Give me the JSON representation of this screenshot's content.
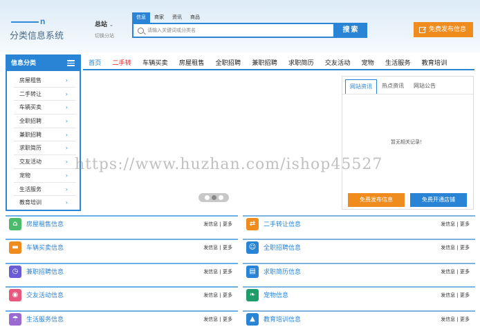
{
  "header": {
    "logo_url": "n",
    "logo_text": "分类信息系统",
    "city_name": "总站",
    "city_caret": "⌄",
    "city_switch": "切换分站",
    "post_button": "免费发布信息"
  },
  "search": {
    "tabs": [
      "信息",
      "商家",
      "资讯",
      "商品"
    ],
    "active_tab": 0,
    "placeholder": "请输入关键词或分类名",
    "button": "搜索"
  },
  "sidebar": {
    "title": "信息分类",
    "items": [
      {
        "label": "房屋租售"
      },
      {
        "label": "二手转让"
      },
      {
        "label": "车辆买卖"
      },
      {
        "label": "全职招聘"
      },
      {
        "label": "兼职招聘"
      },
      {
        "label": "求职简历"
      },
      {
        "label": "交友活动"
      },
      {
        "label": "宠物"
      },
      {
        "label": "生活服务"
      },
      {
        "label": "教育培训"
      }
    ]
  },
  "nav": {
    "items": [
      "首页",
      "二手转",
      "车辆买卖",
      "房屋租售",
      "全职招聘",
      "兼职招聘",
      "求职简历",
      "交友活动",
      "宠物",
      "生活服务",
      "教育培训"
    ]
  },
  "info_box": {
    "tabs": [
      "网站资讯",
      "热点资讯",
      "网站公告"
    ],
    "empty_text": "暂无相关记录！",
    "btn_post": "免费发布信息",
    "btn_shop": "免费开通店铺"
  },
  "sections": [
    {
      "title": "房屋租售信息",
      "links": "发信息 | 更多",
      "color": "#4cbb6b",
      "icon": "house-icon"
    },
    {
      "title": "二手转让信息",
      "links": "发信息 | 更多",
      "color": "#f08c1e",
      "icon": "transfer-icon"
    },
    {
      "title": "车辆买卖信息",
      "links": "发信息 | 更多",
      "color": "#f08c1e",
      "icon": "car-icon"
    },
    {
      "title": "全职招聘信息",
      "links": "发信息 | 更多",
      "color": "#2a84d6",
      "icon": "job-icon"
    },
    {
      "title": "兼职招聘信息",
      "links": "发信息 | 更多",
      "color": "#6a5bd6",
      "icon": "clock-icon"
    },
    {
      "title": "求职简历信息",
      "links": "发信息 | 更多",
      "color": "#2a84d6",
      "icon": "resume-icon"
    },
    {
      "title": "交友活动信息",
      "links": "发信息 | 更多",
      "color": "#e8577e",
      "icon": "chat-icon"
    },
    {
      "title": "宠物信息",
      "links": "发信息 | 更多",
      "color": "#1e9c6a",
      "icon": "pet-icon"
    },
    {
      "title": "生活服务信息",
      "links": "发信息 | 更多",
      "color": "#9a6ad0",
      "icon": "umbrella-icon"
    },
    {
      "title": "教育培训信息",
      "links": "发信息 | 更多",
      "color": "#2a84d6",
      "icon": "graduation-icon"
    }
  ],
  "watermark": "https://www.huzhan.com/ishop45527"
}
